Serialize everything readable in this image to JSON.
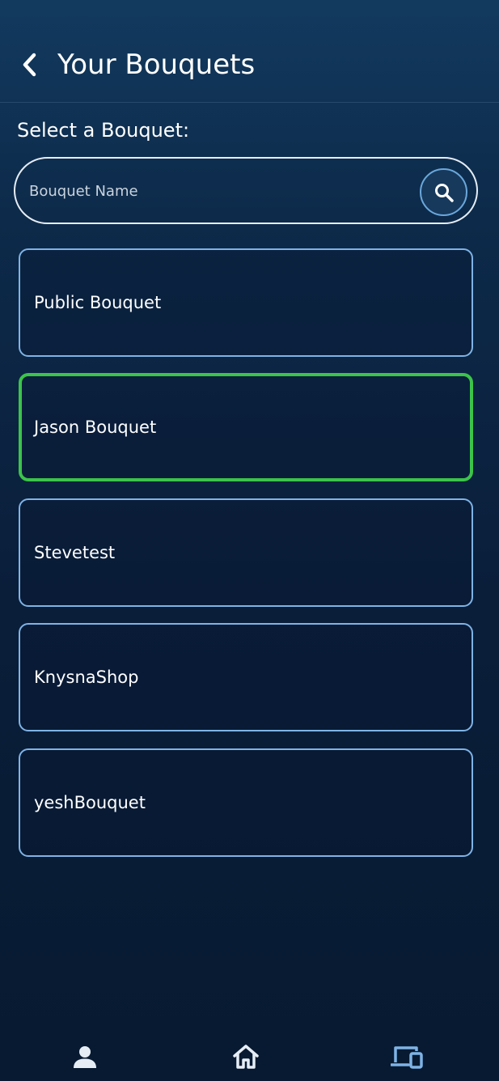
{
  "header": {
    "title": "Your Bouquets",
    "back_icon": "chevron-left-icon"
  },
  "selector": {
    "label": "Select a Bouquet:",
    "search": {
      "placeholder": "Bouquet Name",
      "value": "",
      "icon": "search-icon"
    }
  },
  "bouquets": [
    {
      "name": "Public Bouquet",
      "selected": false
    },
    {
      "name": "Jason Bouquet",
      "selected": true
    },
    {
      "name": "Stevetest",
      "selected": false
    },
    {
      "name": "KnysnaShop",
      "selected": false
    },
    {
      "name": "yeshBouquet",
      "selected": false
    }
  ],
  "bottom_nav": [
    {
      "icon": "user-icon",
      "active": false
    },
    {
      "icon": "home-icon",
      "active": false
    },
    {
      "icon": "devices-icon",
      "active": true
    }
  ],
  "colors": {
    "card_border": "#7fb3e6",
    "selected_border": "#3cc44a",
    "nav_icon": "#e6edf5",
    "nav_icon_active": "#7fb3e6"
  }
}
